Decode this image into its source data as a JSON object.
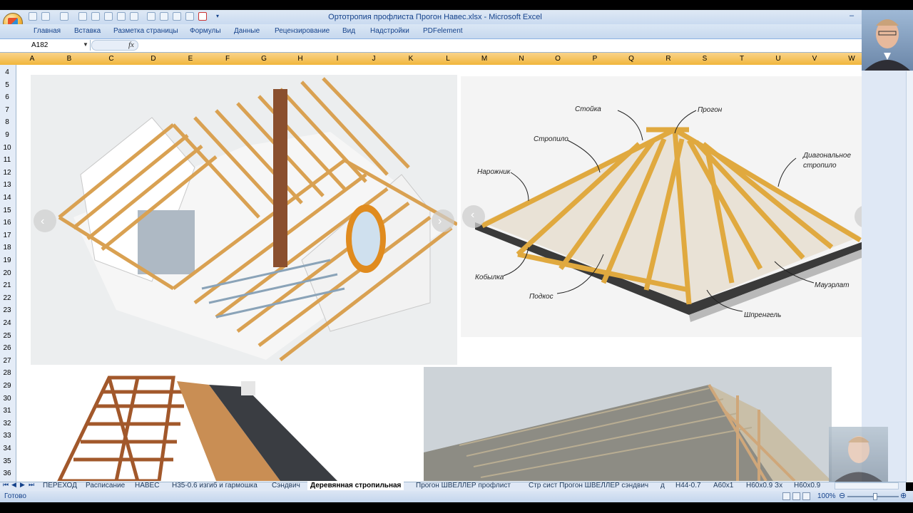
{
  "window": {
    "title": "Ортотропия профлиста Прогон Навес.xlsx - Microsoft Excel",
    "minimize": "–"
  },
  "ribbon": {
    "tabs": [
      "Главная",
      "Вставка",
      "Разметка страницы",
      "Формулы",
      "Данные",
      "Рецензирование",
      "Вид",
      "Надстройки",
      "PDFelement"
    ]
  },
  "formula_bar": {
    "name_box": "A182",
    "fx": "fx"
  },
  "columns": [
    "A",
    "B",
    "C",
    "D",
    "E",
    "F",
    "G",
    "H",
    "I",
    "J",
    "K",
    "L",
    "M",
    "N",
    "O",
    "P",
    "Q",
    "R",
    "S",
    "T",
    "U",
    "V",
    "W"
  ],
  "rows": [
    "4",
    "5",
    "6",
    "7",
    "8",
    "9",
    "10",
    "11",
    "12",
    "13",
    "14",
    "15",
    "16",
    "17",
    "18",
    "19",
    "20",
    "21",
    "22",
    "23",
    "24",
    "25",
    "26",
    "27",
    "28",
    "29",
    "30",
    "31",
    "32",
    "33",
    "34",
    "35",
    "36"
  ],
  "diagram_labels": {
    "stoyka": "Стойка",
    "progon": "Прогон",
    "stropilo": "Стропило",
    "diag": "Диагональное",
    "diag2": "стропило",
    "narozhnik": "Нарожник",
    "kobylka": "Кобылка",
    "podkos": "Подкос",
    "mauerlat": "Мауэрлат",
    "shprengel": "Шпренгель"
  },
  "sheet_tabs": [
    "ПЕРЕХОД",
    "Расписание",
    "НАВЕС",
    "Н35-0.6 изгиб и гармошка",
    "Сэндвич",
    "Деревянная стропильная",
    "Прогон ШВЕЛЛЕР профлист",
    "Стр сист Прогон ШВЕЛЛЕР сэндвич",
    "д",
    "Н44-0.7",
    "А60х1",
    "Н60х0.9 Зх",
    "Н60х0.9"
  ],
  "active_sheet_index": 5,
  "status": {
    "ready": "Готово",
    "zoom": "100%"
  },
  "colors": {
    "header": "#f1b63c",
    "ribbon": "#c7d8ee",
    "accent": "#15428b"
  }
}
